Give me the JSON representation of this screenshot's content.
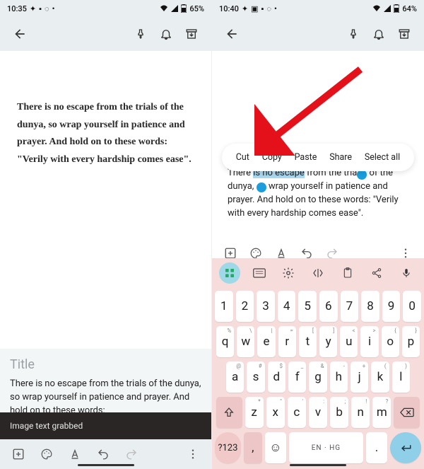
{
  "left": {
    "status": {
      "time": "10:35",
      "battery": "65%"
    },
    "quote": "There is no escape from the trials of the dunya, so wrap yourself in patience and prayer. And hold on to these words: \"Verily with every hardship comes ease\".",
    "title_placeholder": "Title",
    "body_preview": "There is no escape from the trials of the dunya, so wrap yourself in patience and prayer. And hold on to these words:",
    "toast": "Image text grabbed"
  },
  "right": {
    "status": {
      "time": "10:40",
      "battery": "64%"
    },
    "context_menu": [
      "Cut",
      "Copy",
      "Paste",
      "Share",
      "Select all"
    ],
    "editor": {
      "pre": "There ",
      "sel": "is no escape",
      "post1": " from the tria",
      "post2": " of the dunya, ",
      "post3": " wrap yourself in patience and prayer. And hold on to these words: \"Verily with every hardship comes ease\"."
    },
    "keyboard": {
      "row_num": [
        "1",
        "2",
        "3",
        "4",
        "5",
        "6",
        "7",
        "8",
        "9",
        "0"
      ],
      "row_q": [
        "q",
        "w",
        "e",
        "r",
        "t",
        "y",
        "u",
        "i",
        "o",
        "p"
      ],
      "row_a": [
        "a",
        "s",
        "d",
        "f",
        "g",
        "h",
        "j",
        "k",
        "l"
      ],
      "row_z": [
        "z",
        "x",
        "c",
        "v",
        "b",
        "n",
        "m"
      ],
      "num_label": "?123",
      "space_label": "EN · HG"
    }
  }
}
